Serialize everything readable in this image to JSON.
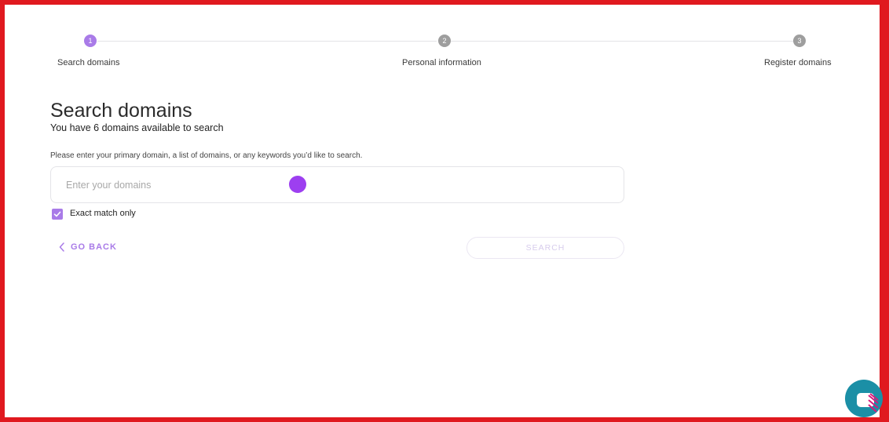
{
  "stepper": {
    "steps": [
      {
        "number": "1",
        "label": "Search domains",
        "state": "active"
      },
      {
        "number": "2",
        "label": "Personal information",
        "state": "inactive"
      },
      {
        "number": "3",
        "label": "Register domains",
        "state": "inactive"
      }
    ]
  },
  "main": {
    "title": "Search domains",
    "subtitle": "You have 6 domains available to search",
    "instruction": "Please enter your primary domain, a list of domains, or any keywords you’d like to search.",
    "search_input": {
      "value": "",
      "placeholder": "Enter your domains"
    },
    "exact_match": {
      "label": "Exact match only",
      "checked": true
    },
    "go_back_label": "GO BACK",
    "search_button_label": "SEARCH"
  },
  "colors": {
    "accent": "#a97be8",
    "inactive_step": "#9e9e9e",
    "frame_border": "#e0191f",
    "cursor_dot": "#9d3ff0",
    "chat_widget": "#1b8fa6"
  },
  "icons": {
    "back": "chevron-left-icon",
    "checkbox": "check-icon",
    "chat": "chat-icon"
  }
}
